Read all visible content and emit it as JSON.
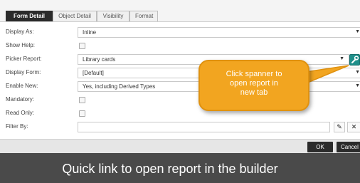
{
  "tabs": [
    {
      "label": "Form Detail",
      "active": true
    },
    {
      "label": "Object Detail",
      "active": false
    },
    {
      "label": "Visibility",
      "active": false
    },
    {
      "label": "Format",
      "active": false
    }
  ],
  "fields": {
    "display_as": {
      "label": "Display As:",
      "value": "Inline"
    },
    "show_help": {
      "label": "Show Help:"
    },
    "picker_report": {
      "label": "Picker Report:",
      "value": "Library cards"
    },
    "display_form": {
      "label": "Display Form:",
      "value": "[Default]"
    },
    "enable_new": {
      "label": "Enable New:",
      "value": "Yes, including Derived Types"
    },
    "mandatory": {
      "label": "Mandatory:"
    },
    "read_only": {
      "label": "Read Only:"
    },
    "filter_by": {
      "label": "Filter By:",
      "value": ""
    }
  },
  "icons": {
    "caret": "▼",
    "spanner": "wrench-icon",
    "pencil": "✎",
    "clear": "✕"
  },
  "footer": {
    "ok_label": "OK",
    "cancel_label": "Cancel"
  },
  "callout": {
    "line1": "Click spanner to",
    "line2": "open report in",
    "line3": "new tab"
  },
  "caption": "Quick link to open report in the builder",
  "colors": {
    "accent_teal": "#1e8f8a",
    "callout_orange": "#f2a520",
    "caption_bg": "#4a4a4a",
    "dark_button": "#2b2b2b"
  }
}
